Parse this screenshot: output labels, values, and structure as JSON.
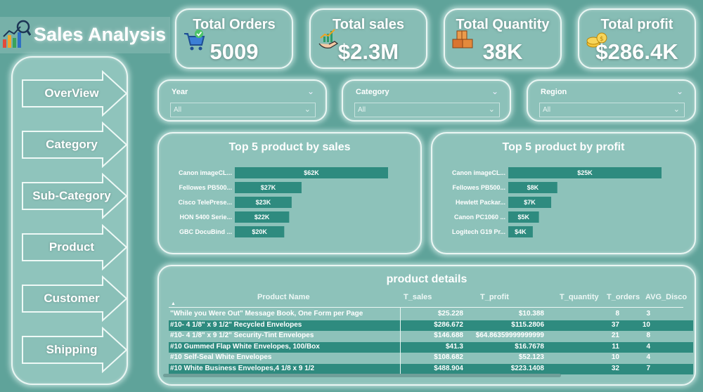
{
  "header": {
    "title": "Sales Analysis",
    "logo_icon": "analytics-chart-icon"
  },
  "kpis": [
    {
      "label": "Total Orders",
      "value": "5009",
      "icon": "shopping-cart-icon"
    },
    {
      "label": "Total sales",
      "value": "$2.3M",
      "icon": "money-growth-icon"
    },
    {
      "label": "Total Quantity",
      "value": "38K",
      "icon": "boxes-icon"
    },
    {
      "label": "Total profit",
      "value": "$286.4K",
      "icon": "coins-icon"
    }
  ],
  "nav": [
    {
      "label": "OverView"
    },
    {
      "label": "Category"
    },
    {
      "label": "Sub-Category"
    },
    {
      "label": "Product"
    },
    {
      "label": "Customer"
    },
    {
      "label": "Shipping"
    }
  ],
  "filters": [
    {
      "label": "Year",
      "value": "All"
    },
    {
      "label": "Category",
      "value": "All"
    },
    {
      "label": "Region",
      "value": "All"
    }
  ],
  "chart_data": [
    {
      "type": "bar",
      "orientation": "horizontal",
      "title": "Top 5 product by sales",
      "categories": [
        "Canon imageCL...",
        "Fellowes PB500...",
        "Cisco TelePrese...",
        "HON 5400 Serie...",
        "GBC DocuBind ..."
      ],
      "values": [
        62,
        27,
        23,
        22,
        20
      ],
      "data_labels": [
        "$62K",
        "$27K",
        "$23K",
        "$22K",
        "$20K"
      ],
      "bar_color": "#2e8b7f"
    },
    {
      "type": "bar",
      "orientation": "horizontal",
      "title": "Top 5 product by profit",
      "categories": [
        "Canon imageCL...",
        "Fellowes PB500...",
        "Hewlett Packar...",
        "Canon PC1060 ...",
        "Logitech G19 Pr..."
      ],
      "values": [
        25,
        8,
        7,
        5,
        4
      ],
      "data_labels": [
        "$25K",
        "$8K",
        "$7K",
        "$5K",
        "$4K"
      ],
      "bar_color": "#2e8b7f"
    }
  ],
  "table": {
    "title": "product details",
    "columns": [
      "Product Name",
      "T_sales",
      "T_profit",
      "T_quantity",
      "T_orders",
      "AVG_Disco"
    ],
    "rows": [
      [
        "\"While you Were Out\" Message Book, One Form per Page",
        "$25.228",
        "$10.388",
        "8",
        "3"
      ],
      [
        "#10- 4 1/8\" x 9 1/2\" Recycled Envelopes",
        "$286.672",
        "$115.2806",
        "37",
        "10"
      ],
      [
        "#10- 4 1/8\" x 9 1/2\" Security-Tint Envelopes",
        "$146.688",
        "$64.86359999999999",
        "21",
        "8"
      ],
      [
        "#10 Gummed Flap White Envelopes, 100/Box",
        "$41.3",
        "$16.7678",
        "11",
        "4"
      ],
      [
        "#10 Self-Seal White Envelopes",
        "$108.682",
        "$52.123",
        "10",
        "4"
      ],
      [
        "#10 White Business Envelopes,4 1/8 x 9 1/2",
        "$488.904",
        "$223.1408",
        "32",
        "7"
      ]
    ]
  }
}
